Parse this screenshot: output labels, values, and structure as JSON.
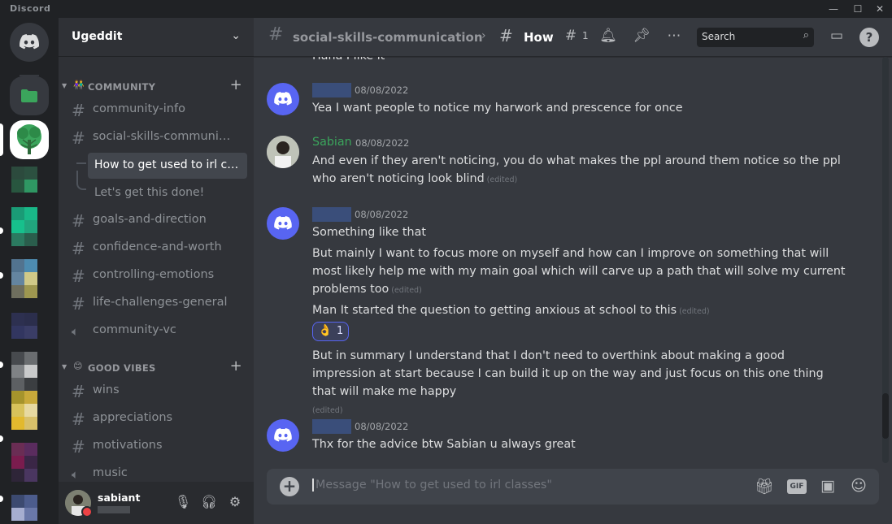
{
  "app": {
    "name": "Discord"
  },
  "window": {
    "minimize": "—",
    "maximize": "☐",
    "close": "✕"
  },
  "server": {
    "name": "Ugeddit"
  },
  "categories": [
    {
      "label": "COMMUNITY",
      "emoji": "👫"
    },
    {
      "label": "GOOD VIBES",
      "emoji": "😊"
    }
  ],
  "channels": {
    "community_info": "community-info",
    "social_skills": "social-skills-communication",
    "thread_active": "How to get used to irl classes",
    "thread_other": "Let's get this done!",
    "goals": "goals-and-direction",
    "confidence": "confidence-and-worth",
    "controlling": "controlling-emotions",
    "life": "life-challenges-general",
    "community_vc": "community-vc",
    "wins": "wins",
    "appreciations": "appreciations",
    "motivations": "motivations",
    "music": "music"
  },
  "user": {
    "name": "sabiant"
  },
  "topbar": {
    "channel": "social-skills-communication",
    "separator": "›",
    "thread": "How",
    "thread_count": "1",
    "search_placeholder": "Search"
  },
  "messages": [
    {
      "id": "m0",
      "text": "Haha I like it"
    },
    {
      "id": "m1",
      "timestamp": "08/08/2022",
      "text": "Yea I want people to notice my harwork and prescence for once"
    },
    {
      "id": "m2",
      "author": "Sabian",
      "timestamp": "08/08/2022",
      "text": "And even if they aren't noticing, you do what makes the ppl around them notice so the ppl who aren't noticing look blind",
      "edited": "(edited)"
    },
    {
      "id": "m3",
      "timestamp": "08/08/2022",
      "text": "Something like that"
    },
    {
      "id": "m4",
      "text": "But mainly I want to focus more on myself and how can I improve on something that will most likely help me with my main goal which will carve up a path that will solve my current problems too",
      "edited": "(edited)"
    },
    {
      "id": "m5",
      "text": "Man It started the question to getting anxious at school to this",
      "edited": "(edited)"
    },
    {
      "id": "m6",
      "text": "But in summary I understand that I don't need to overthink about making a good impression at start because I can build it up on the way and just focus on this one thing that will make me happy",
      "edited": "(edited)"
    },
    {
      "id": "m7",
      "timestamp": "08/08/2022",
      "text": "Thx for the advice btw Sabian u always great"
    }
  ],
  "reaction": {
    "emoji": "👌",
    "count": "1"
  },
  "composer": {
    "placeholder": "Message \"How to get used to irl classes\"",
    "gif": "GIF"
  },
  "colors": {
    "blurple": "#5865f2",
    "green": "#3ba55c",
    "dnd": "#ed4245"
  }
}
